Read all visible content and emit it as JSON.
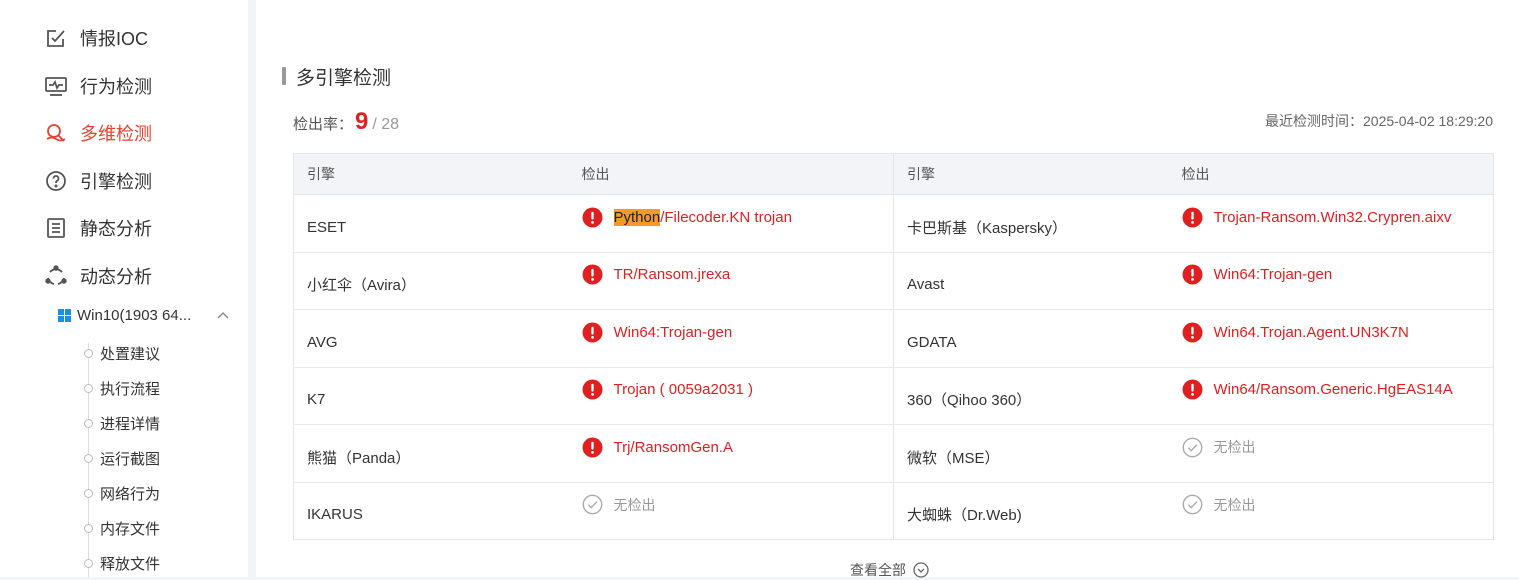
{
  "sidebar": {
    "items": [
      {
        "label": "情报IOC",
        "icon": "edit-checkbox-icon"
      },
      {
        "label": "行为检测",
        "icon": "monitor-pulse-icon"
      },
      {
        "label": "多维检测",
        "icon": "multi-search-icon",
        "active": true
      },
      {
        "label": "引擎检测",
        "icon": "question-circle-icon"
      },
      {
        "label": "静态分析",
        "icon": "document-list-icon"
      },
      {
        "label": "动态分析",
        "icon": "cycle-dots-icon"
      }
    ],
    "sub_env": "Win10(1903 64...",
    "sub_items": [
      "处置建议",
      "执行流程",
      "进程详情",
      "运行截图",
      "网络行为",
      "内存文件",
      "释放文件"
    ]
  },
  "section": {
    "title": "多引擎检测"
  },
  "rate": {
    "label": "检出率：",
    "value": "9",
    "total": "/ 28"
  },
  "last_check": "最近检测时间：2025-04-02 18:29:20",
  "table": {
    "headers": [
      "引擎",
      "检出",
      "引擎",
      "检出"
    ],
    "rows": [
      {
        "left": {
          "engine": "ESET",
          "result": "/Filecoder.KN trojan",
          "highlight": "Python",
          "detected": true
        },
        "right": {
          "engine": "卡巴斯基（Kaspersky）",
          "result": "Trojan-Ransom.Win32.Crypren.aixv",
          "detected": true
        }
      },
      {
        "left": {
          "engine": "小红伞（Avira）",
          "result": "TR/Ransom.jrexa",
          "detected": true
        },
        "right": {
          "engine": "Avast",
          "result": "Win64:Trojan-gen",
          "detected": true
        }
      },
      {
        "left": {
          "engine": "AVG",
          "result": "Win64:Trojan-gen",
          "detected": true
        },
        "right": {
          "engine": "GDATA",
          "result": "Win64.Trojan.Agent.UN3K7N",
          "detected": true
        }
      },
      {
        "left": {
          "engine": "K7",
          "result": "Trojan ( 0059a2031 )",
          "detected": true
        },
        "right": {
          "engine": "360（Qihoo 360）",
          "result": "Win64/Ransom.Generic.HgEAS14A",
          "detected": true
        }
      },
      {
        "left": {
          "engine": "熊猫（Panda）",
          "result": "Trj/RansomGen.A",
          "detected": true
        },
        "right": {
          "engine": "微软（MSE）",
          "result": "无检出",
          "detected": false
        }
      },
      {
        "left": {
          "engine": "IKARUS",
          "result": "无检出",
          "detected": false
        },
        "right": {
          "engine": "大蜘蛛（Dr.Web)",
          "result": "无检出",
          "detected": false
        }
      }
    ]
  },
  "view_all": "查看全部",
  "colors": {
    "accent": "#e8432e",
    "detected": "#e02020",
    "not_detected": "#999999",
    "highlight": "#f59a2a"
  }
}
